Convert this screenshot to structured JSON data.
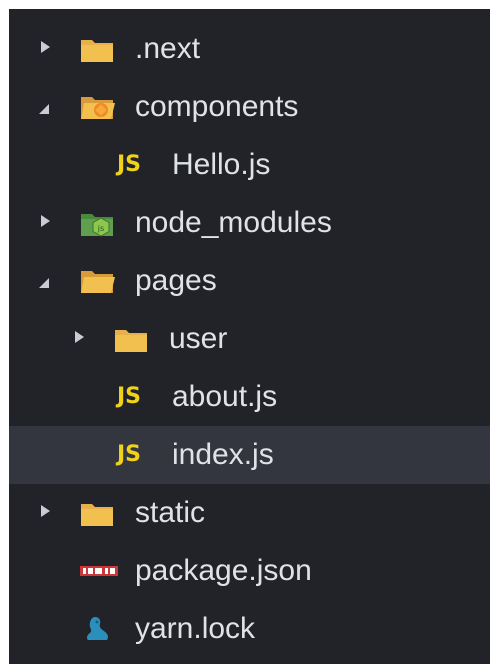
{
  "tree": {
    "items": [
      {
        "label": ".next",
        "kind": "folder",
        "expanded": false,
        "icon": "folder-icon"
      },
      {
        "label": "components",
        "kind": "folder",
        "expanded": true,
        "icon": "components-folder-icon"
      },
      {
        "label": "Hello.js",
        "kind": "file",
        "icon": "js-file-icon",
        "icon_text": "JS"
      },
      {
        "label": "node_modules",
        "kind": "folder",
        "expanded": false,
        "icon": "node-modules-folder-icon"
      },
      {
        "label": "pages",
        "kind": "folder",
        "expanded": true,
        "icon": "folder-open-icon"
      },
      {
        "label": "user",
        "kind": "folder",
        "expanded": false,
        "icon": "folder-icon"
      },
      {
        "label": "about.js",
        "kind": "file",
        "icon": "js-file-icon",
        "icon_text": "JS"
      },
      {
        "label": "index.js",
        "kind": "file",
        "selected": true,
        "icon": "js-file-icon",
        "icon_text": "JS"
      },
      {
        "label": "static",
        "kind": "folder",
        "expanded": false,
        "icon": "folder-icon"
      },
      {
        "label": "package.json",
        "kind": "file",
        "icon": "npm-icon"
      },
      {
        "label": "yarn.lock",
        "kind": "file",
        "icon": "yarn-icon"
      }
    ]
  },
  "colors": {
    "background": "#222329",
    "selected_row": "#33363f",
    "text": "#dfe2e7",
    "folder": "#e8b04b",
    "js": "#f1d21b",
    "npm": "#cb3837",
    "yarn": "#2c8ebb",
    "node": "#5fa04e"
  }
}
